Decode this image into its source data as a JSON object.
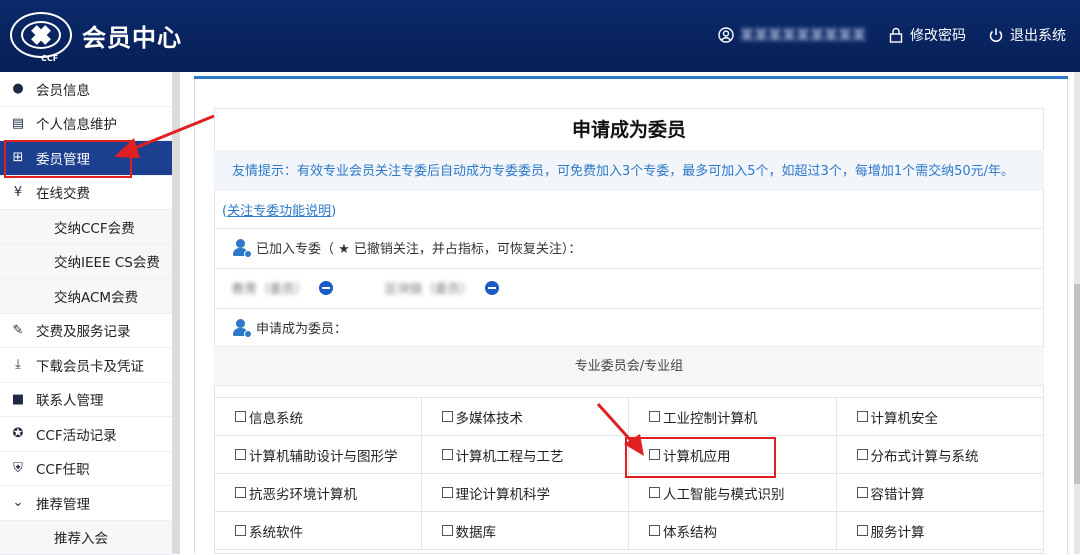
{
  "header": {
    "logo_text": "CCF",
    "title": "会员中心",
    "user_name": "某某某某某某某某某",
    "change_password": "修改密码",
    "logout": "退出系统",
    "colors": {
      "bar": "#0a2a6b",
      "text": "#ffffff"
    }
  },
  "sidebar": {
    "items": [
      {
        "label": "会员信息",
        "icon": "user-icon"
      },
      {
        "label": "个人信息维护",
        "icon": "card-icon"
      },
      {
        "label": "委员管理",
        "icon": "grid-icon",
        "active": true
      },
      {
        "label": "在线交费",
        "icon": "yen-circle-icon"
      },
      {
        "label": "交纳CCF会费",
        "sub": true
      },
      {
        "label": "交纳IEEE CS会费",
        "sub": true
      },
      {
        "label": "交纳ACM会费",
        "sub": true
      },
      {
        "label": "交费及服务记录",
        "icon": "pencil-icon"
      },
      {
        "label": "下载会员卡及凭证",
        "icon": "download-icon"
      },
      {
        "label": "联系人管理",
        "icon": "contact-icon"
      },
      {
        "label": "CCF活动记录",
        "icon": "star-circle-icon"
      },
      {
        "label": "CCF任职",
        "icon": "shield-icon"
      },
      {
        "label": "推荐管理",
        "icon": "chevron-circle-icon"
      },
      {
        "label": "推荐入会",
        "sub": true
      }
    ],
    "colors": {
      "active_bg": "#1c3f8f",
      "active_text": "#ffffff"
    }
  },
  "main": {
    "title": "申请成为委员",
    "tip": "友情提示：有效专业会员关注专委后自动成为专委委员，可免费加入3个专委，最多可加入5个，如超过3个，每增加1个需交纳50元/年。",
    "link_prefix": "(",
    "link_text": "关注专委功能说明",
    "link_suffix": ")",
    "joined_label": "已加入专委（ ★ 已撤销关注，并占指标，可恢复关注）：",
    "joined_items": [
      "教育（委员）",
      "区块链（委员）"
    ],
    "apply_label": "申请成为委员：",
    "committee_header": "专业委员会/专业组",
    "committees": [
      "信息系统",
      "多媒体技术",
      "工业控制计算机",
      "计算机安全",
      "计算机辅助设计与图形学",
      "计算机工程与工艺",
      "计算机应用",
      "分布式计算与系统",
      "抗恶劣环境计算机",
      "理论计算机科学",
      "人工智能与模式识别",
      "容错计算",
      "系统软件",
      "数据库",
      "体系结构",
      "服务计算"
    ],
    "colors": {
      "accent": "#2d78c9",
      "annotation": "#e02020"
    }
  }
}
